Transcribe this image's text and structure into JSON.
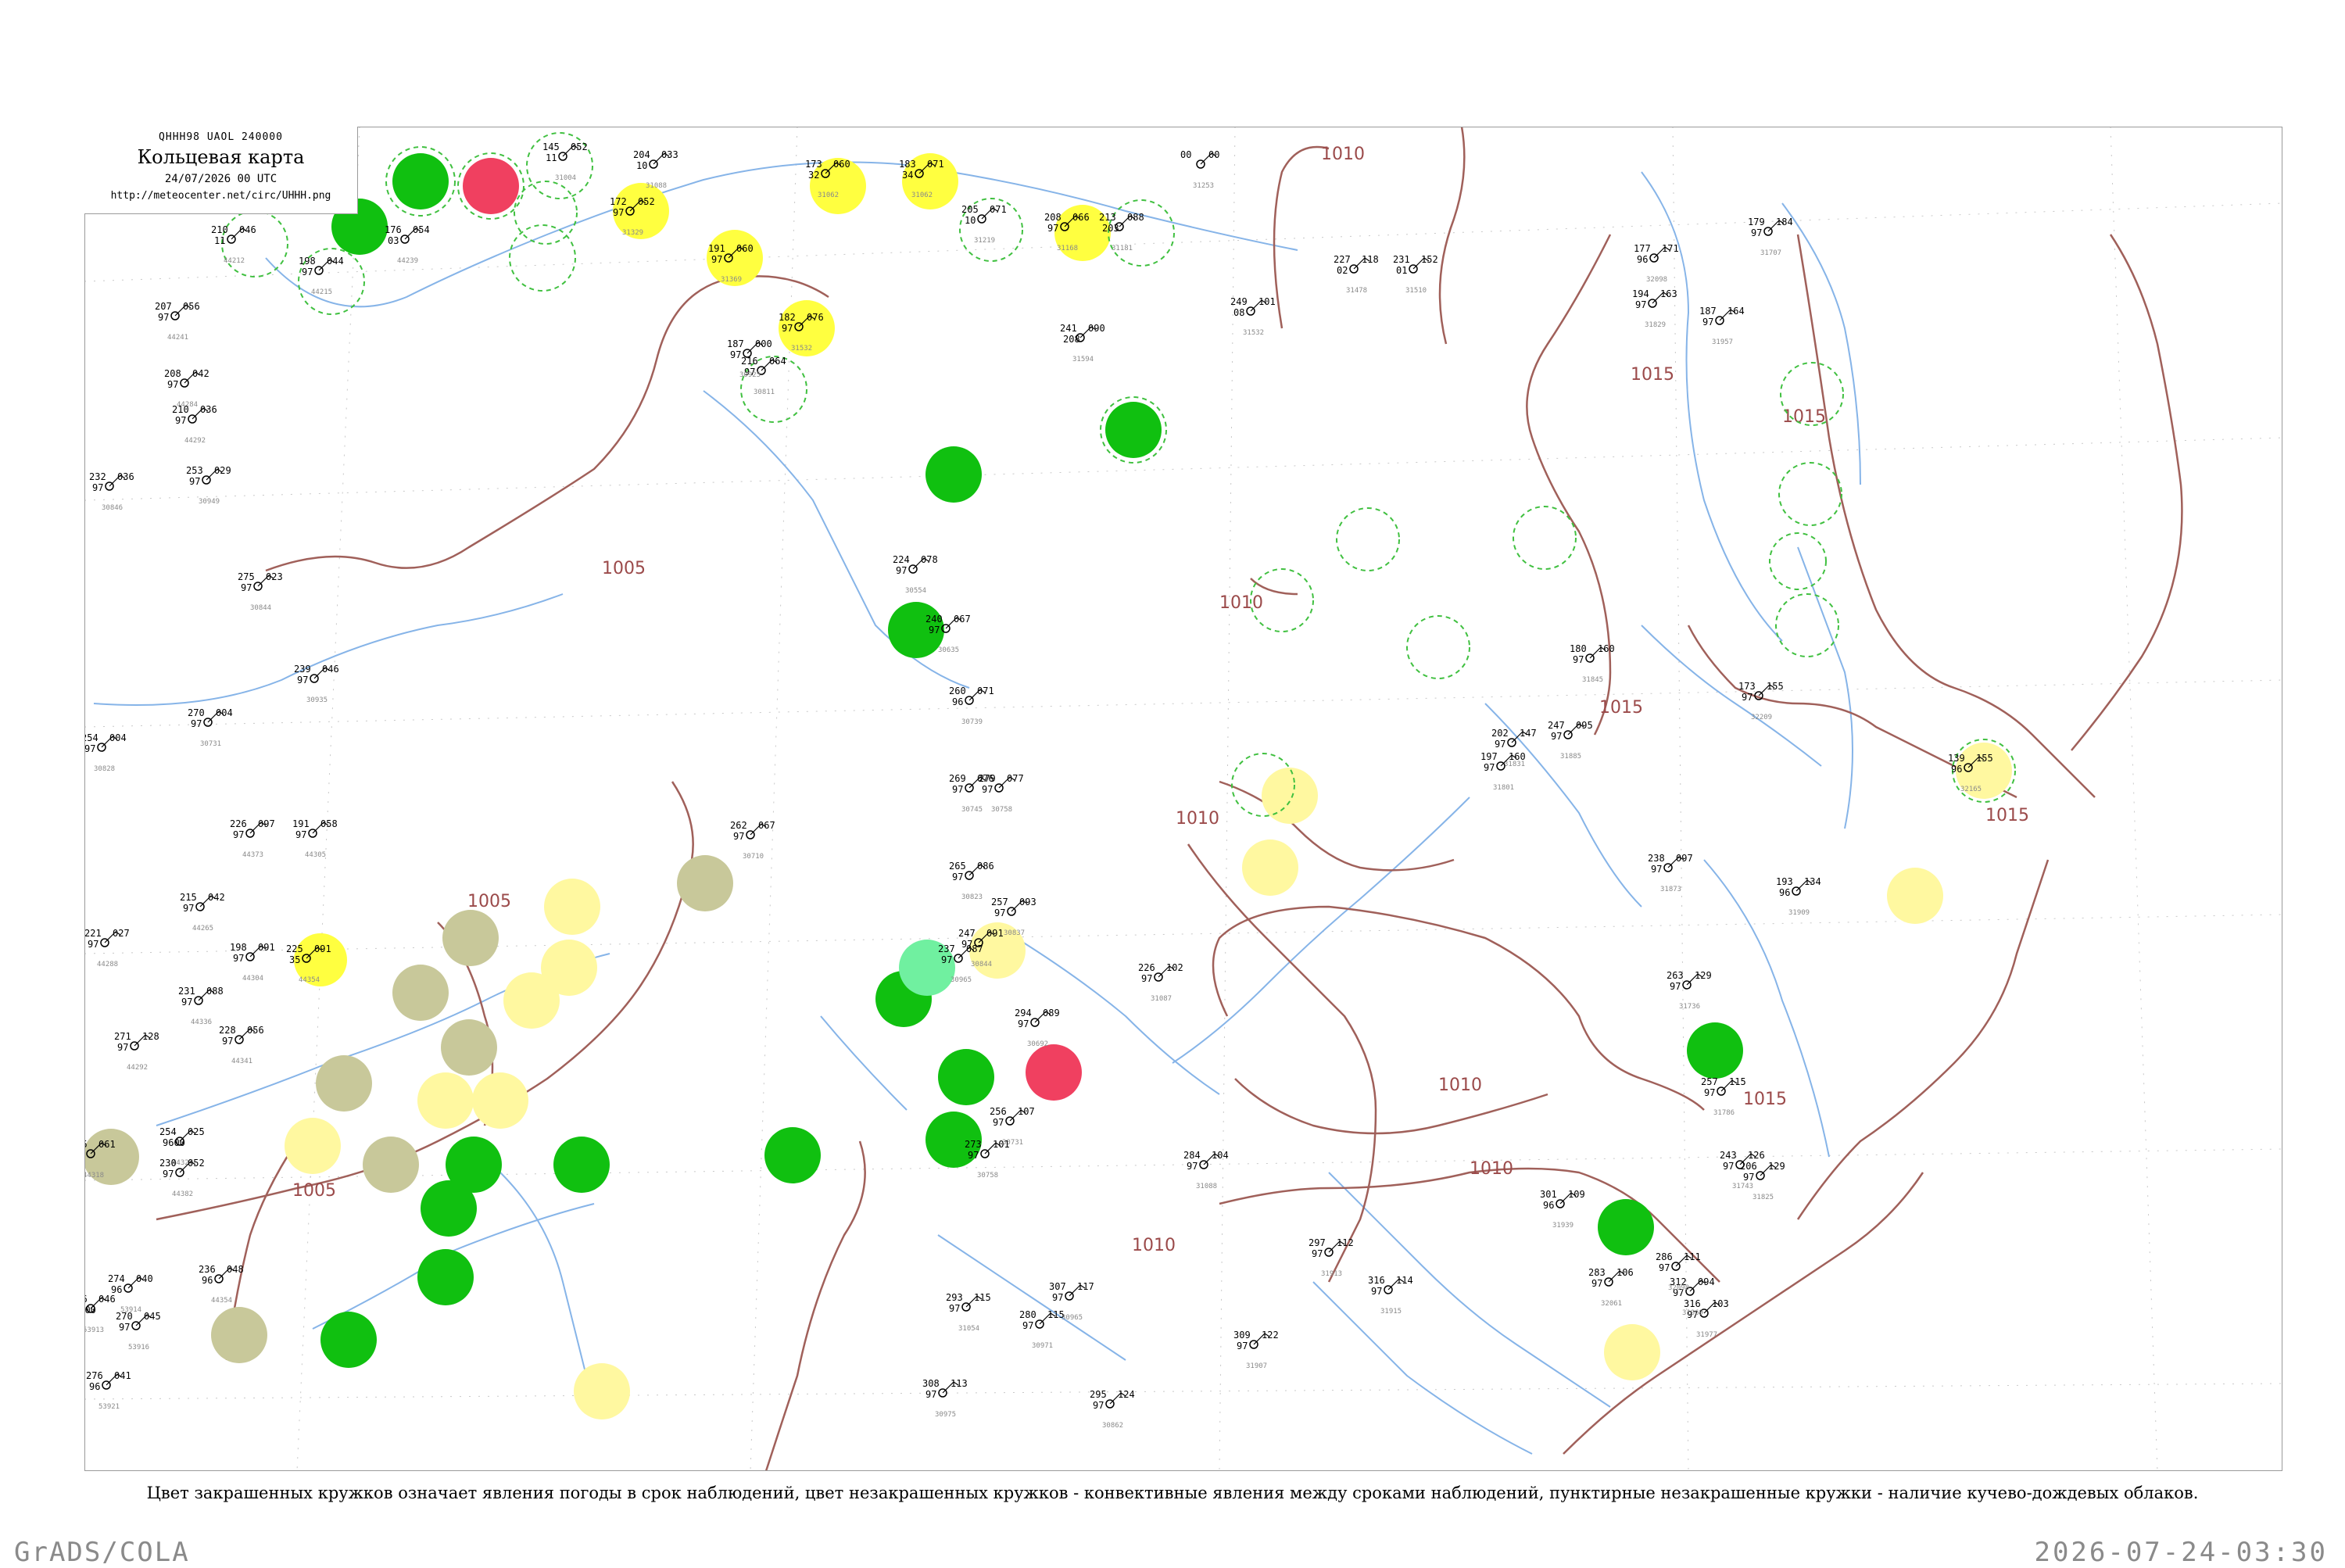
{
  "header": {
    "code": "QHHH98  UAOL  240000",
    "title": "Кольцевая карта",
    "date": "24/07/2026 00 UTC",
    "url": "http://meteocenter.net/circ/UHHH.png"
  },
  "caption": "Цвет закрашенных кружков означает явления погоды в срок наблюдений, цвет незакрашенных кружков - конвективные явления между сроками наблюдений, пунктирные незакрашенные кружки - наличие кучево-дождевых облаков.",
  "footer": {
    "left": "GrADS/COLA",
    "right": "2026-07-24-03:30"
  },
  "colors": {
    "isobar": "#a0605a",
    "river": "#88b6e6",
    "coast": "#4a90e0",
    "green": "#10c010",
    "yellow": "#ffff60",
    "light_yellow": "#fff8a0",
    "khaki": "#c8c89a",
    "red": "#f04060",
    "light_green": "#70f0a0",
    "dashed_green": "#40c040"
  },
  "isobar_labels": [
    "1010",
    "1005",
    "1005",
    "1010",
    "1010",
    "1010",
    "1010",
    "1010",
    "1015",
    "1015",
    "1015",
    "1015",
    "1015",
    "1005"
  ],
  "stations": [
    {
      "id": "31004",
      "t": "145",
      "p": "052",
      "v": "11"
    },
    {
      "id": "31088",
      "t": "204",
      "p": "033",
      "v": "10"
    },
    {
      "id": "31062",
      "t": "173",
      "p": "060",
      "v": "32"
    },
    {
      "id": "31062b",
      "t": "183",
      "p": "071",
      "v": "34"
    },
    {
      "id": "31219",
      "t": "205",
      "p": "071",
      "v": "10"
    },
    {
      "id": "31168",
      "t": "208",
      "p": "066",
      "v": "97"
    },
    {
      "id": "31181",
      "t": "213",
      "p": "088",
      "v": "203"
    },
    {
      "id": "31253",
      "t": "00",
      "p": "00",
      "v": ""
    },
    {
      "id": "44212",
      "t": "210",
      "p": "046",
      "v": "11"
    },
    {
      "id": "44215",
      "t": "198",
      "p": "044",
      "v": "97"
    },
    {
      "id": "44239",
      "t": "176",
      "p": "054",
      "v": "03"
    },
    {
      "id": "31329",
      "t": "172",
      "p": "052",
      "v": "97"
    },
    {
      "id": "31369",
      "t": "191",
      "p": "060",
      "v": "97"
    },
    {
      "id": "31532",
      "t": "182",
      "p": "076",
      "v": "97"
    },
    {
      "id": "30811",
      "t": "216",
      "p": "064",
      "v": "97"
    },
    {
      "id": "31478",
      "t": "227",
      "p": "118",
      "v": "02"
    },
    {
      "id": "31510",
      "t": "231",
      "p": "152",
      "v": "01"
    },
    {
      "id": "31707",
      "t": "179",
      "p": "184",
      "v": "97"
    },
    {
      "id": "32098",
      "t": "177",
      "p": "171",
      "v": "96"
    },
    {
      "id": "31532b",
      "t": "249",
      "p": "101",
      "v": "08"
    },
    {
      "id": "31594",
      "t": "241",
      "p": "090",
      "v": "208"
    },
    {
      "id": "30925",
      "t": "187",
      "p": "000",
      "v": "97"
    },
    {
      "id": "31829",
      "t": "194",
      "p": "163",
      "v": "97"
    },
    {
      "id": "31957",
      "t": "187",
      "p": "164",
      "v": "97"
    },
    {
      "id": "44241",
      "t": "207",
      "p": "056",
      "v": "97"
    },
    {
      "id": "44284",
      "t": "208",
      "p": "042",
      "v": "97"
    },
    {
      "id": "44292",
      "t": "210",
      "p": "036",
      "v": "97"
    },
    {
      "id": "30846",
      "t": "232",
      "p": "036",
      "v": "97"
    },
    {
      "id": "30949",
      "t": "253",
      "p": "029",
      "v": "97"
    },
    {
      "id": "30844",
      "t": "275",
      "p": "023",
      "v": "97"
    },
    {
      "id": "30935",
      "t": "239",
      "p": "046",
      "v": "97"
    },
    {
      "id": "30828",
      "t": "254",
      "p": "004",
      "v": "97"
    },
    {
      "id": "30731",
      "t": "270",
      "p": "004",
      "v": "97"
    },
    {
      "id": "44373",
      "t": "226",
      "p": "097",
      "v": "97"
    },
    {
      "id": "44305",
      "t": "191",
      "p": "058",
      "v": "97"
    },
    {
      "id": "44265",
      "t": "215",
      "p": "042",
      "v": "97"
    },
    {
      "id": "44288",
      "t": "221",
      "p": "027",
      "v": "97"
    },
    {
      "id": "44304",
      "t": "198",
      "p": "091",
      "v": "97"
    },
    {
      "id": "44354",
      "t": "225",
      "p": "091",
      "v": "35"
    },
    {
      "id": "44336",
      "t": "231",
      "p": "088",
      "v": "97"
    },
    {
      "id": "44341",
      "t": "228",
      "p": "056",
      "v": "97"
    },
    {
      "id": "44292b",
      "t": "271",
      "p": "128",
      "v": "97"
    },
    {
      "id": "44318",
      "t": "245",
      "p": "061",
      "v": "96"
    },
    {
      "id": "44327",
      "t": "254",
      "p": "025",
      "v": "9600"
    },
    {
      "id": "44382",
      "t": "230",
      "p": "052",
      "v": "97"
    },
    {
      "id": "44354b",
      "t": "236",
      "p": "048",
      "v": "96"
    },
    {
      "id": "53913",
      "t": "276",
      "p": "046",
      "v": "9600"
    },
    {
      "id": "53914",
      "t": "274",
      "p": "040",
      "v": "96"
    },
    {
      "id": "53916",
      "t": "270",
      "p": "045",
      "v": "97"
    },
    {
      "id": "53921",
      "t": "276",
      "p": "041",
      "v": "96"
    },
    {
      "id": "30710",
      "t": "262",
      "p": "067",
      "v": "97"
    },
    {
      "id": "30554",
      "t": "224",
      "p": "078",
      "v": "97"
    },
    {
      "id": "30635",
      "t": "240",
      "p": "067",
      "v": "97"
    },
    {
      "id": "30739",
      "t": "260",
      "p": "071",
      "v": "96"
    },
    {
      "id": "30745",
      "t": "269",
      "p": "076",
      "v": "97"
    },
    {
      "id": "30758",
      "t": "279",
      "p": "077",
      "v": "97"
    },
    {
      "id": "30823",
      "t": "265",
      "p": "086",
      "v": "97"
    },
    {
      "id": "30837",
      "t": "257",
      "p": "093",
      "v": "97"
    },
    {
      "id": "30844b",
      "t": "247",
      "p": "091",
      "v": "97"
    },
    {
      "id": "30965",
      "t": "237",
      "p": "087",
      "v": "97"
    },
    {
      "id": "31087",
      "t": "226",
      "p": "102",
      "v": "97"
    },
    {
      "id": "30692",
      "t": "294",
      "p": "089",
      "v": "97"
    },
    {
      "id": "30731b",
      "t": "256",
      "p": "107",
      "v": "97"
    },
    {
      "id": "30758b",
      "t": "273",
      "p": "101",
      "v": "97"
    },
    {
      "id": "31088b",
      "t": "284",
      "p": "104",
      "v": "97"
    },
    {
      "id": "30965b",
      "t": "307",
      "p": "117",
      "v": "97"
    },
    {
      "id": "30971",
      "t": "280",
      "p": "115",
      "v": "97"
    },
    {
      "id": "31054",
      "t": "293",
      "p": "115",
      "v": "97"
    },
    {
      "id": "30975",
      "t": "308",
      "p": "113",
      "v": "97"
    },
    {
      "id": "30862",
      "t": "295",
      "p": "124",
      "v": "97"
    },
    {
      "id": "31907",
      "t": "309",
      "p": "122",
      "v": "97"
    },
    {
      "id": "31913",
      "t": "297",
      "p": "112",
      "v": "97"
    },
    {
      "id": "31915",
      "t": "316",
      "p": "114",
      "v": "97"
    },
    {
      "id": "31939",
      "t": "301",
      "p": "109",
      "v": "96"
    },
    {
      "id": "31977",
      "t": "316",
      "p": "103",
      "v": "97"
    },
    {
      "id": "31969",
      "t": "312",
      "p": "094",
      "v": "97"
    },
    {
      "id": "32061",
      "t": "283",
      "p": "106",
      "v": "97"
    },
    {
      "id": "32098b",
      "t": "286",
      "p": "111",
      "v": "97"
    },
    {
      "id": "31736",
      "t": "263",
      "p": "129",
      "v": "97"
    },
    {
      "id": "31786",
      "t": "257",
      "p": "115",
      "v": "97"
    },
    {
      "id": "31743",
      "t": "243",
      "p": "126",
      "v": "97"
    },
    {
      "id": "31825",
      "t": "206",
      "p": "129",
      "v": "97"
    },
    {
      "id": "31873",
      "t": "238",
      "p": "097",
      "v": "97"
    },
    {
      "id": "31909",
      "t": "193",
      "p": "134",
      "v": "96"
    },
    {
      "id": "32165",
      "t": "139",
      "p": "155",
      "v": "96"
    },
    {
      "id": "32209",
      "t": "173",
      "p": "155",
      "v": "97"
    },
    {
      "id": "31885",
      "t": "247",
      "p": "095",
      "v": "97"
    },
    {
      "id": "31831",
      "t": "202",
      "p": "147",
      "v": "97"
    },
    {
      "id": "31801",
      "t": "197",
      "p": "160",
      "v": "97"
    },
    {
      "id": "31845",
      "t": "180",
      "p": "160",
      "v": "97"
    }
  ]
}
